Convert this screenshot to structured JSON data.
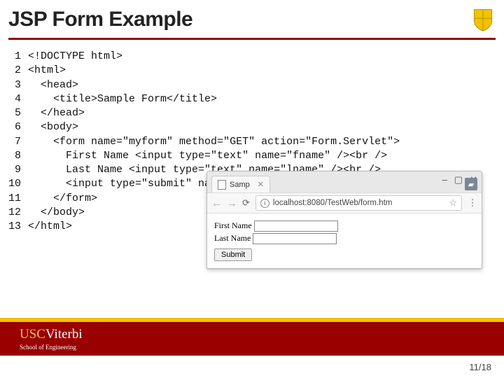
{
  "slide": {
    "title": "JSP Form Example",
    "page": "11/18"
  },
  "code": {
    "line_numbers": "1\n2\n3\n4\n5\n6\n7\n8\n9\n10\n11\n12\n13",
    "source": "<!DOCTYPE html>\n<html>\n  <head>\n    <title>Sample Form</title>\n  </head>\n  <body>\n    <form name=\"myform\" method=\"GET\" action=\"Form.Servlet\">\n      First Name <input type=\"text\" name=\"fname\" /><br />\n      Last Name <input type=\"text\" name=\"lname\" /><br />\n      <input type=\"submit\" name=\"submit\" value=\"Submit\" />\n    </form>\n  </body>\n</html>"
  },
  "browser": {
    "tab_title": "Samp",
    "window_min": "–",
    "window_max": "▢",
    "window_close": "✕",
    "url": "localhost:8080/TestWeb/form.htm",
    "form": {
      "label_first": "First Name",
      "label_last": "Last Name",
      "submit": "Submit"
    }
  },
  "footer": {
    "brand_a": "USC",
    "brand_b": "Viterbi",
    "school": "School of Engineering"
  }
}
